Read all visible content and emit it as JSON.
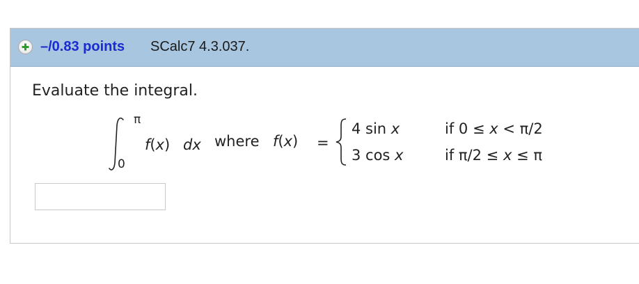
{
  "question": {
    "points_label": "–/0.83 points",
    "code": "SCalc7 4.3.037.",
    "icon": "plus-icon",
    "prompt": "Evaluate the integral.",
    "answer_value": ""
  },
  "math": {
    "upper_limit": "π",
    "lower_limit": "0",
    "integrand": "f(x)",
    "dx": "dx",
    "where": "where",
    "fx": "f(x)",
    "equals": "=",
    "case1_expr": "4 sin x",
    "case1_cond": "if 0 ≤ x < π/2",
    "case2_expr": "3 cos x",
    "case2_cond": "if π/2 ≤ x ≤ π"
  },
  "colors": {
    "header_bg": "#a9c6e0",
    "points_text": "#1a2ccf",
    "plus_icon": "#2e9a2e"
  }
}
